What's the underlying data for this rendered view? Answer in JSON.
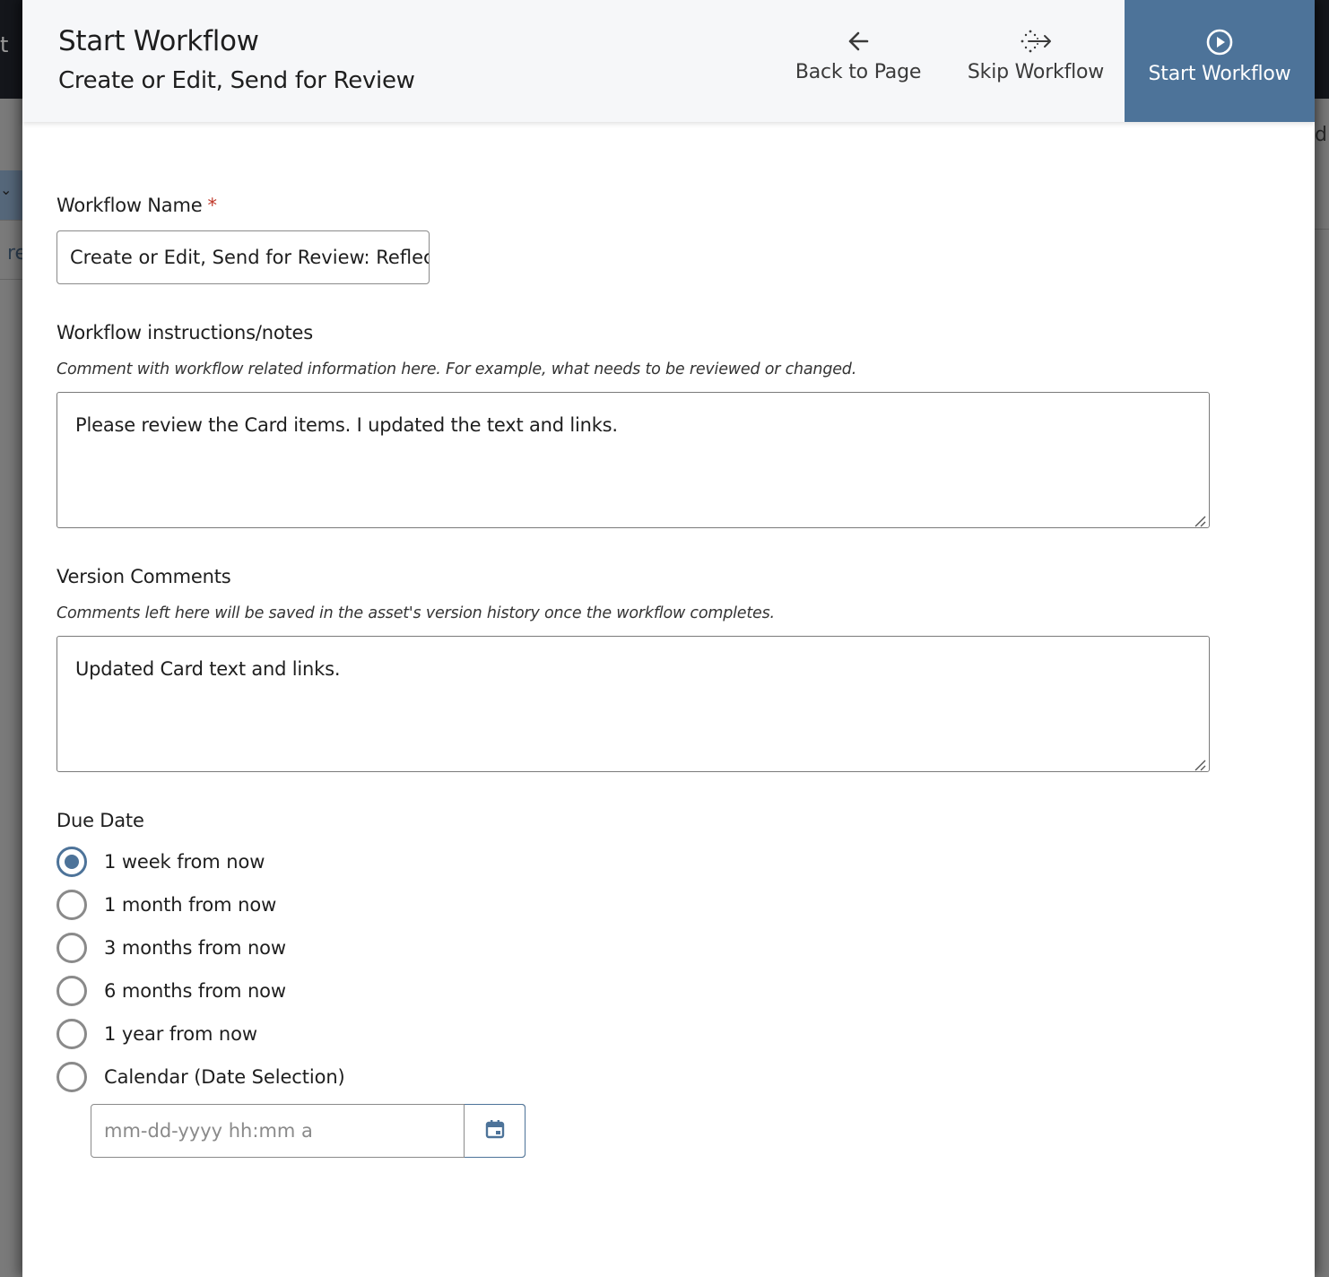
{
  "background": {
    "topbar_fragment": "t",
    "left_fragment": "re",
    "right_fragment": "dit"
  },
  "header": {
    "title": "Start Workflow",
    "subtitle": "Create or Edit, Send for Review",
    "actions": [
      {
        "label": "Back to Page",
        "icon": "arrow-left-icon"
      },
      {
        "label": "Skip Workflow",
        "icon": "skip-dotted-arrow-icon"
      },
      {
        "label": "Start Workflow",
        "icon": "play-circle-icon",
        "active": true
      }
    ]
  },
  "form": {
    "workflow_name": {
      "label": "Workflow Name",
      "required_marker": "*",
      "value": "Create or Edit, Send for Review: Reflec"
    },
    "instructions": {
      "label": "Workflow instructions/notes",
      "hint": "Comment with workflow related information here. For example, what needs to be reviewed or changed.",
      "value": "Please review the Card items. I updated the text and links."
    },
    "version_comments": {
      "label": "Version Comments",
      "hint": "Comments left here will be saved in the asset's version history once the workflow completes.",
      "value": "Updated Card text and links."
    },
    "due_date": {
      "label": "Due Date",
      "options": [
        {
          "label": "1 week from now",
          "checked": true
        },
        {
          "label": "1 month from now",
          "checked": false
        },
        {
          "label": "3 months from now",
          "checked": false
        },
        {
          "label": "6 months from now",
          "checked": false
        },
        {
          "label": "1 year from now",
          "checked": false
        },
        {
          "label": "Calendar (Date Selection)",
          "checked": false
        }
      ],
      "date_placeholder": "mm-dd-yyyy hh:mm a"
    }
  },
  "colors": {
    "accent": "#4d7399",
    "required": "#c0392b",
    "header_bg": "#f6f7f9"
  }
}
